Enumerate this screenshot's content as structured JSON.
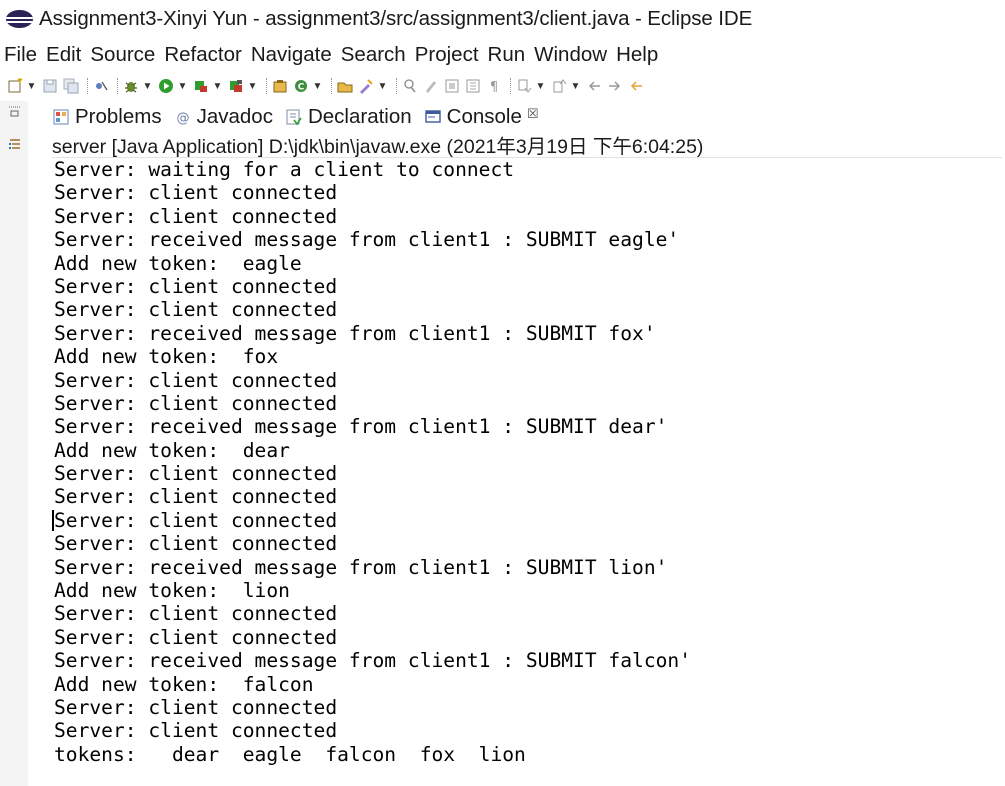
{
  "window": {
    "title": "Assignment3-Xinyi Yun - assignment3/src/assignment3/client.java - Eclipse IDE",
    "logo_icon": "eclipse-logo-icon",
    "logo_color": "#2c2255"
  },
  "menu": {
    "items": [
      "File",
      "Edit",
      "Source",
      "Refactor",
      "Navigate",
      "Search",
      "Project",
      "Run",
      "Window",
      "Help"
    ]
  },
  "toolbar": {
    "icons": [
      "new-icon",
      "save-icon",
      "save-all-icon",
      "skip-breakpoints-icon",
      "debug-icon",
      "run-icon",
      "coverage-icon",
      "external-tools-icon",
      "new-java-project-icon",
      "new-package-icon",
      "open-type-icon",
      "search-icon",
      "annotation-icon",
      "toggle-breadcrumb-icon",
      "block-selection-icon",
      "show-whitespace-icon",
      "next-annotation-icon",
      "prev-annotation-icon",
      "back-icon",
      "forward-icon",
      "last-edit-icon"
    ]
  },
  "views": {
    "tabs": [
      {
        "label": "Problems",
        "icon": "problems-icon"
      },
      {
        "label": "Javadoc",
        "icon": "javadoc-icon"
      },
      {
        "label": "Declaration",
        "icon": "declaration-icon"
      },
      {
        "label": "Console",
        "icon": "console-icon",
        "active": true,
        "close_glyph": "☒"
      }
    ]
  },
  "console": {
    "header": "server [Java Application] D:\\jdk\\bin\\javaw.exe  (2021年3月19日 下午6:04:25)",
    "lines": [
      "Server: waiting for a client to connect",
      "Server: client connected",
      "Server: client connected",
      "Server: received message from client1 : SUBMIT eagle'",
      "Add new token:  eagle",
      "Server: client connected",
      "Server: client connected",
      "Server: received message from client1 : SUBMIT fox'",
      "Add new token:  fox",
      "Server: client connected",
      "Server: client connected",
      "Server: received message from client1 : SUBMIT dear'",
      "Add new token:  dear",
      "Server: client connected",
      "Server: client connected",
      "Server: client connected",
      "Server: client connected",
      "Server: received message from client1 : SUBMIT lion'",
      "Add new token:  lion",
      "Server: client connected",
      "Server: client connected",
      "Server: received message from client1 : SUBMIT falcon'",
      "Add new token:  falcon",
      "Server: client connected",
      "Server: client connected",
      "tokens:   dear  eagle  falcon  fox  lion"
    ]
  }
}
